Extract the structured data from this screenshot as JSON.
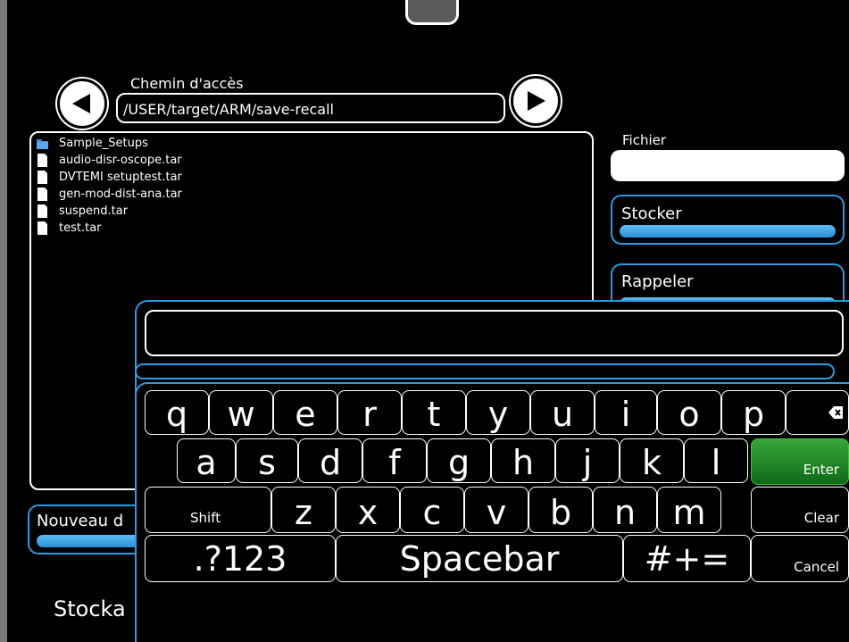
{
  "path": {
    "label": "Chemin d'accès",
    "value": "/USER/target/ARM/save-recall"
  },
  "files": [
    {
      "name": "Sample_Setups",
      "type": "folder"
    },
    {
      "name": "audio-disr-oscope.tar",
      "type": "file"
    },
    {
      "name": "DVTEMI setuptest.tar",
      "type": "file"
    },
    {
      "name": "gen-mod-dist-ana.tar",
      "type": "file"
    },
    {
      "name": "suspend.tar",
      "type": "file"
    },
    {
      "name": "test.tar",
      "type": "file"
    }
  ],
  "right": {
    "fichier_label": "Fichier",
    "fichier_value": "",
    "stocker_label": "Stocker",
    "rappeler_label": "Rappeler"
  },
  "bottom": {
    "nouveau_label": "Nouveau d",
    "status_label": "Stocka"
  },
  "keyboard": {
    "input_value": "",
    "row1": [
      "q",
      "w",
      "e",
      "r",
      "t",
      "y",
      "u",
      "i",
      "o",
      "p"
    ],
    "row2": [
      "a",
      "s",
      "d",
      "f",
      "g",
      "h",
      "j",
      "k",
      "l"
    ],
    "row3": [
      "z",
      "x",
      "c",
      "v",
      "b",
      "n",
      "m"
    ],
    "shift": "Shift",
    "enter": "Enter",
    "clear": "Clear",
    "cancel": "Cancel",
    "num": ".?123",
    "space": "Spacebar",
    "sym": "#+="
  },
  "colors": {
    "accent": "#2d9be0",
    "enter": "#1f8a2a",
    "background": "#000000"
  },
  "icons": {
    "back": "arrow-left-icon",
    "forward": "arrow-right-icon",
    "folder": "folder-icon",
    "file": "file-icon",
    "backspace": "backspace-icon"
  }
}
